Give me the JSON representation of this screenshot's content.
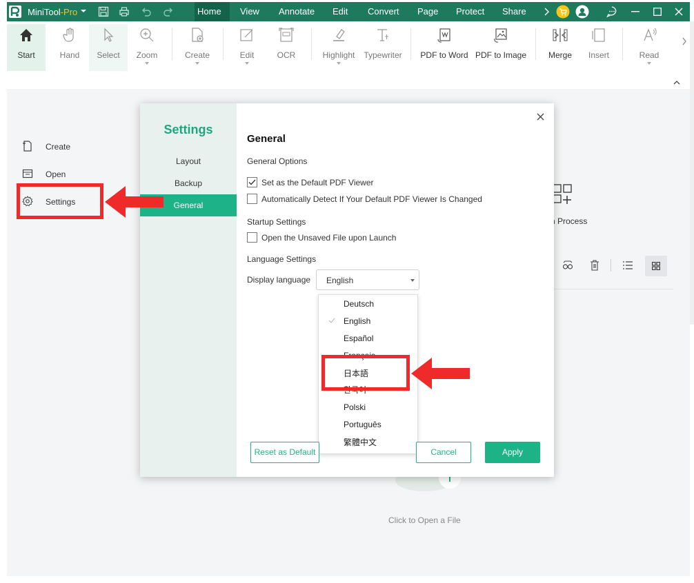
{
  "app": {
    "name": "MiniTool",
    "edition": "-Pro"
  },
  "menu": {
    "items": [
      "Home",
      "View",
      "Annotate",
      "Edit",
      "Convert",
      "Page",
      "Protect",
      "Share"
    ]
  },
  "ribbon": {
    "start": "Start",
    "hand": "Hand",
    "select": "Select",
    "zoom": "Zoom",
    "create": "Create",
    "edit": "Edit",
    "ocr": "OCR",
    "highlight": "Highlight",
    "typewriter": "Typewriter",
    "pdf_to_word": "PDF to Word",
    "pdf_to_image": "PDF to Image",
    "merge": "Merge",
    "insert": "Insert",
    "read": "Read"
  },
  "sidebar": {
    "create": "Create",
    "open": "Open",
    "settings": "Settings"
  },
  "background": {
    "batch_process": "h Process",
    "click_to_open": "Click to Open a File"
  },
  "settings": {
    "title": "Settings",
    "nav": [
      "Layout",
      "Backup",
      "General"
    ],
    "active_nav": "General",
    "heading": "General",
    "general_options": "General Options",
    "opt_default_viewer": "Set as the Default PDF Viewer",
    "opt_auto_detect": "Automatically Detect If Your Default PDF Viewer Is Changed",
    "startup_settings": "Startup Settings",
    "opt_open_unsaved": "Open the Unsaved File upon Launch",
    "language_settings": "Language Settings",
    "display_language_label": "Display language",
    "display_language_value": "English",
    "languages": [
      "Deutsch",
      "English",
      "Español",
      "Français",
      "日本語",
      "한국어",
      "Polski",
      "Português",
      "繁體中文"
    ],
    "selected_language": "English",
    "reset_button": "Reset as Default",
    "cancel_button": "Cancel",
    "apply_button": "Apply"
  },
  "colors": {
    "brand_green": "#1d7a5c",
    "accent": "#1eb386",
    "annotation_red": "#ee2a2a"
  }
}
